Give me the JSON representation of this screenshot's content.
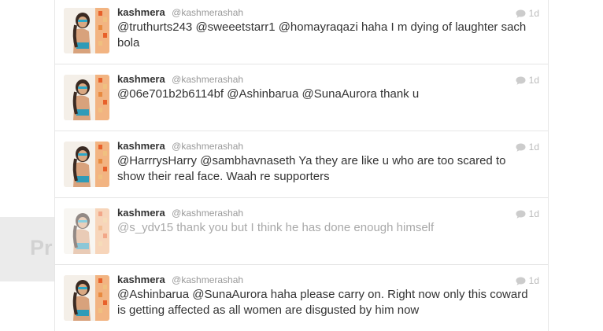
{
  "background": {
    "left_panel_text": "Pr"
  },
  "tweets": [
    {
      "name": "kashmera",
      "handle": "@kashmerashah",
      "time": "1d",
      "text": "@truthurts243 @sweeetstarr1 @homayraqazi haha I m dying of laughter sach bola"
    },
    {
      "name": "kashmera",
      "handle": "@kashmerashah",
      "time": "1d",
      "text": "@06e701b2b6114bf @Ashinbarua @SunaAurora thank u"
    },
    {
      "name": "kashmera",
      "handle": "@kashmerashah",
      "time": "1d",
      "text": "@HarrrysHarry @sambhavnaseth Ya they are like u who are too scared to show their real face. Waah re supporters"
    },
    {
      "name": "kashmera",
      "handle": "@kashmerashah",
      "time": "1d",
      "text": "@s_ydv15 thank you but I think he has done enough himself"
    },
    {
      "name": "kashmera",
      "handle": "@kashmerashah",
      "time": "1d",
      "text": "@Ashinbarua @SunaAurora haha please carry on. Right now only this coward is getting affected as all women are disgusted by him now"
    }
  ],
  "colors": {
    "text": "#333333",
    "muted": "#999999",
    "faded_text": "#a9a9a9",
    "divider": "#e6e6e6"
  },
  "icons": {
    "reply": "speech-bubble-icon",
    "avatar": "profile-photo"
  }
}
